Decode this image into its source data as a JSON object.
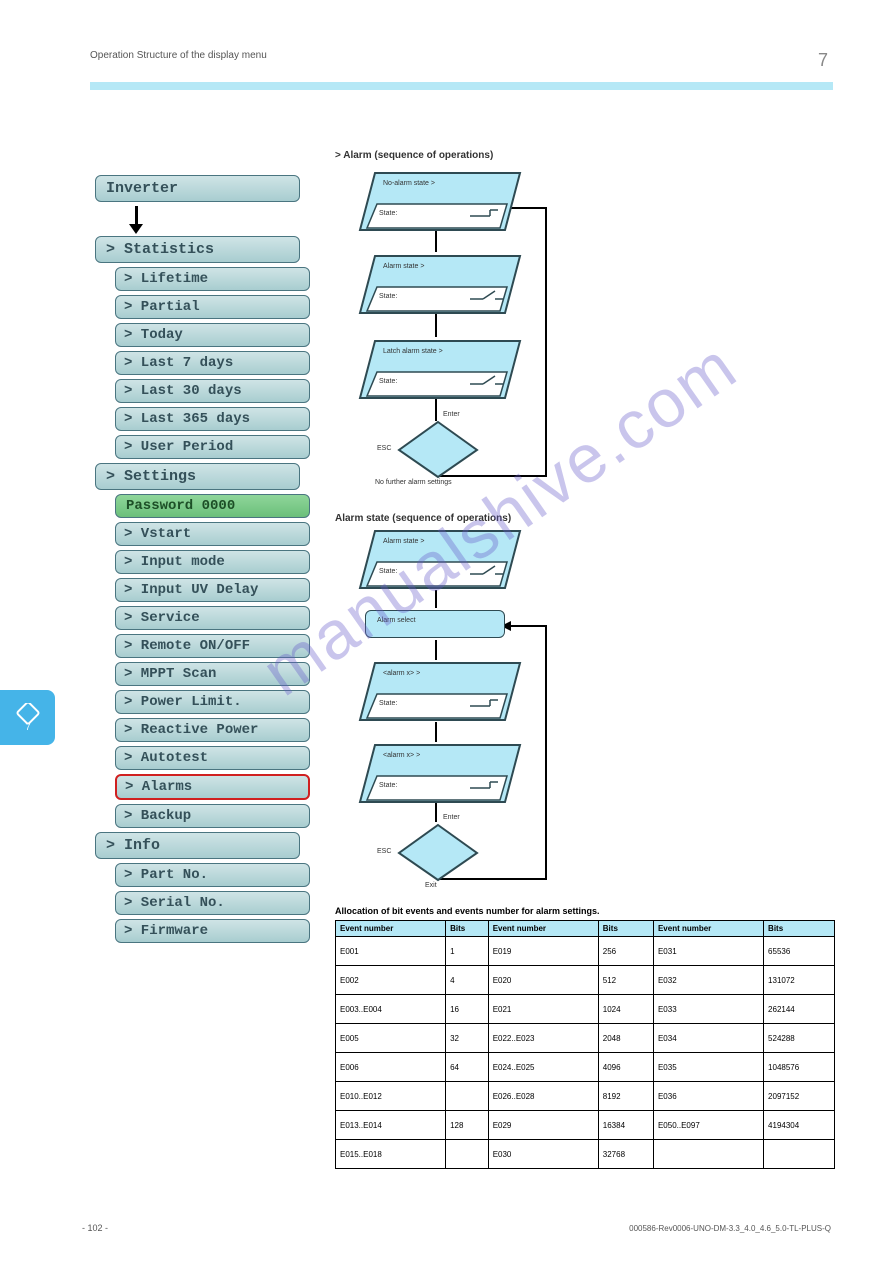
{
  "header": {
    "breadcrumb": "Operation  Structure of the display menu",
    "chapter_no": "7"
  },
  "side_tab_label": "7",
  "menu": {
    "root": "Inverter",
    "statistics": {
      "label": "> Statistics",
      "items": [
        "> Lifetime",
        "> Partial",
        "> Today",
        "> Last 7 days",
        "> Last 30 days",
        "> Last 365 days",
        "> User Period"
      ]
    },
    "settings": {
      "label": "> Settings",
      "password": "Password 0000",
      "items": [
        "> Vstart",
        "> Input mode",
        "> Input UV Delay",
        "> Service",
        "> Remote ON/OFF",
        "> MPPT Scan",
        "> Power Limit.",
        "> Reactive Power",
        "> Autotest",
        "> Alarms",
        "> Backup"
      ]
    },
    "info": {
      "label": "> Info",
      "items": [
        "> Part No.",
        "> Serial No.",
        "> Firmware"
      ]
    },
    "highlighted": "> Alarms"
  },
  "flowcharts": {
    "a": {
      "title": "> Alarm (sequence of operations)",
      "nodes": {
        "n1": {
          "top": "No-alarm state >",
          "bottom": "State:"
        },
        "n2": {
          "top": "Alarm state >",
          "bottom": "State:"
        },
        "n3": {
          "top": "Latch alarm state >",
          "bottom": "State:"
        },
        "d1": {
          "top": "Enter",
          "left": "ESC",
          "out": "No further alarm settings"
        }
      }
    },
    "b": {
      "title": "Alarm state (sequence of operations)",
      "nodes": {
        "n1": {
          "top": "Alarm state >",
          "bottom": "State:"
        },
        "r1": "Alarm select",
        "n2": {
          "top": "<alarm x>    >",
          "bottom": "State:"
        },
        "n3": {
          "top": "<alarm x>    >",
          "bottom": "State:"
        },
        "d1": {
          "top": "Enter",
          "left": "ESC",
          "out": "Exit"
        }
      }
    }
  },
  "table": {
    "title": "Allocation of bit events and events number for alarm settings.",
    "headers": [
      "Event number",
      "Bits",
      "Event number",
      "Bits",
      "Event number",
      "Bits"
    ],
    "rows": [
      [
        "E001",
        "1",
        "E019",
        "256",
        "E031",
        "65536"
      ],
      [
        "E002",
        "4",
        "E020",
        "512",
        "E032",
        "131072"
      ],
      [
        "E003..E004",
        "16",
        "E021",
        "1024",
        "E033",
        "262144"
      ],
      [
        "E005",
        "32",
        "E022..E023",
        "2048",
        "E034",
        "524288"
      ],
      [
        "E006",
        "64",
        "E024..E025",
        "4096",
        "E035",
        "1048576"
      ],
      [
        "E010..E012",
        "",
        "E026..E028",
        "8192",
        "E036",
        "2097152"
      ],
      [
        "E013..E014",
        "128",
        "E029",
        "16384",
        "E050..E097",
        "4194304"
      ],
      [
        "E015..E018",
        "",
        "E030",
        "32768",
        "",
        ""
      ]
    ]
  },
  "footer": {
    "page_no": "- 102 -",
    "doc_id": "000586-Rev0006-UNO-DM-3.3_4.0_4.6_5.0-TL-PLUS-Q"
  },
  "watermark": "manualshive.com"
}
